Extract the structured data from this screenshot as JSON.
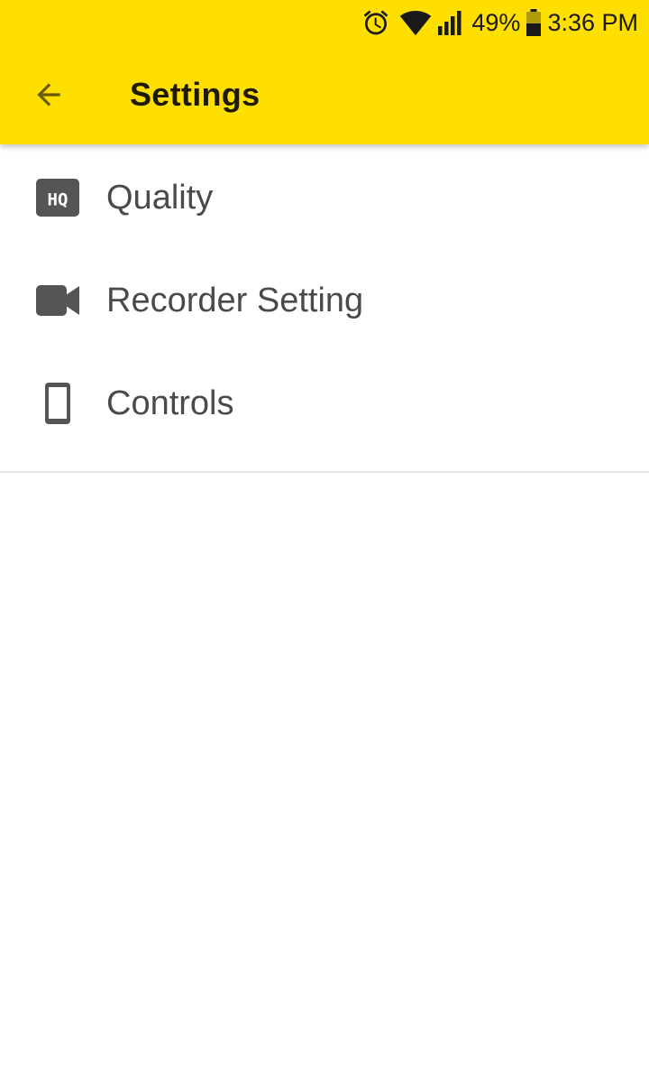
{
  "status_bar": {
    "battery_percent": "49%",
    "time": "3:36 PM",
    "icons": [
      "alarm-icon",
      "wifi-icon",
      "cellular-signal-icon",
      "battery-icon"
    ]
  },
  "app_bar": {
    "title": "Settings",
    "back_icon": "arrow-back-icon",
    "background_color": "#FFDF00"
  },
  "settings": {
    "items": [
      {
        "label": "Quality",
        "icon": "hq-icon"
      },
      {
        "label": "Recorder Setting",
        "icon": "videocam-icon"
      },
      {
        "label": "Controls",
        "icon": "phone-icon"
      }
    ]
  }
}
